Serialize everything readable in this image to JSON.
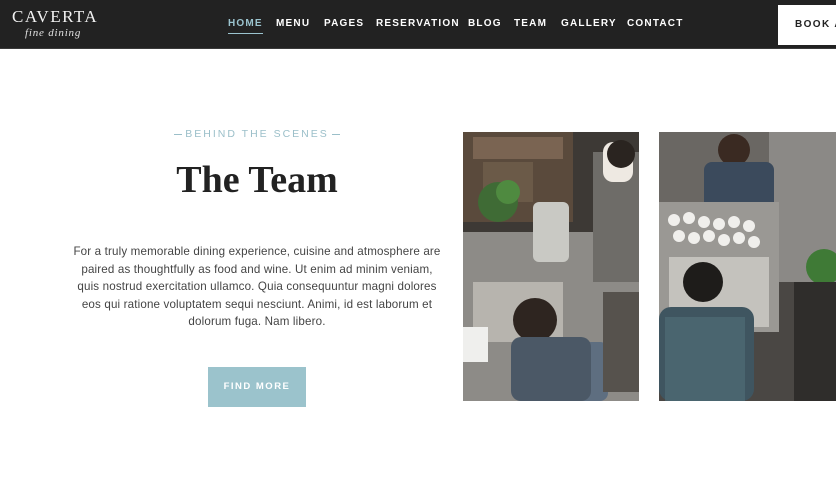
{
  "brand": {
    "name": "CAVERTA",
    "tagline": "fine dining"
  },
  "nav": {
    "items": [
      {
        "label": "HOME",
        "active": true
      },
      {
        "label": "MENU",
        "active": false
      },
      {
        "label": "PAGES",
        "active": false
      },
      {
        "label": "RESERVATION",
        "active": false
      },
      {
        "label": "BLOG",
        "active": false
      },
      {
        "label": "TEAM",
        "active": false
      },
      {
        "label": "GALLERY",
        "active": false
      },
      {
        "label": "CONTACT",
        "active": false
      }
    ],
    "cta_label": "BOOK A"
  },
  "section": {
    "eyebrow": "BEHIND THE SCENES",
    "title": "The Team",
    "body": "For a truly memorable dining experience, cuisine and atmosphere are paired as thoughtfully as food and wine. Ut enim ad minim veniam, quis nostrud exercitation ullamco. Quia consequuntur magni dolores eos qui ratione voluptatem sequi nesciunt. Animi, id est laborum et dolorum fuga. Nam libero.",
    "button_label": "FIND MORE"
  },
  "colors": {
    "header_bg": "#222222",
    "accent": "#9bc3cc",
    "text_dark": "#222222",
    "text_body": "#444444"
  }
}
